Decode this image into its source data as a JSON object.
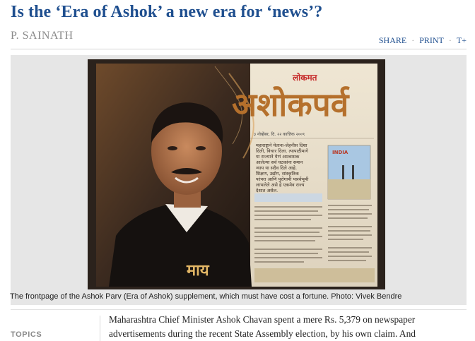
{
  "article": {
    "headline": "Is the ‘Era of Ashok’ a new era for ‘news’?",
    "author": "P. SAINATH",
    "caption": "The frontpage of the Ashok Parv (Era of Ashok) supplement, which must have cost a fortune. Photo: Vivek Bendre",
    "body_line_1": "Maharashtra Chief Minister Ashok Chavan spent a mere Rs. 5,379 on newspaper",
    "body_line_2": "advertisements during the recent State Assembly election, by his own claim. And"
  },
  "tools": {
    "share": "SHARE",
    "print": "PRINT",
    "font": "T+",
    "separator": "·"
  },
  "sidebar": {
    "topics_label": "TOPICS"
  },
  "newspaper": {
    "masthead": "लोकमत",
    "title": "अशोकपर्व",
    "date_line": "३ नोव्हेंबर, दि. २२ कात्तिक २००९",
    "bottom_word": "माय",
    "insert_tag": "INDIA",
    "blurb_lines": [
      "महाराष्ट्राने येताना-जेहनीस दिशा",
      "दिली, विचार दिला. त्यापाठीमागे",
      "या राज्याने येणं आश्वासक",
      "आलेल्या सर्व घटकांना समान",
      "न्याय या सदैव दिले आहे.",
      "शिक्षण, उद्योग, सांस्कृतिक",
      "परंपरा आणि पुरोगामी पार्श्वभूमी",
      "लाभलेले असे हे एकमेव राज्य",
      "देशात असेल."
    ]
  },
  "colors": {
    "headline": "#1f4f8f",
    "byline": "#8a8a8a",
    "photo_frame": "#e6e6e6",
    "masthead_red": "#c62a2a",
    "title_gold": "#b5702c"
  }
}
